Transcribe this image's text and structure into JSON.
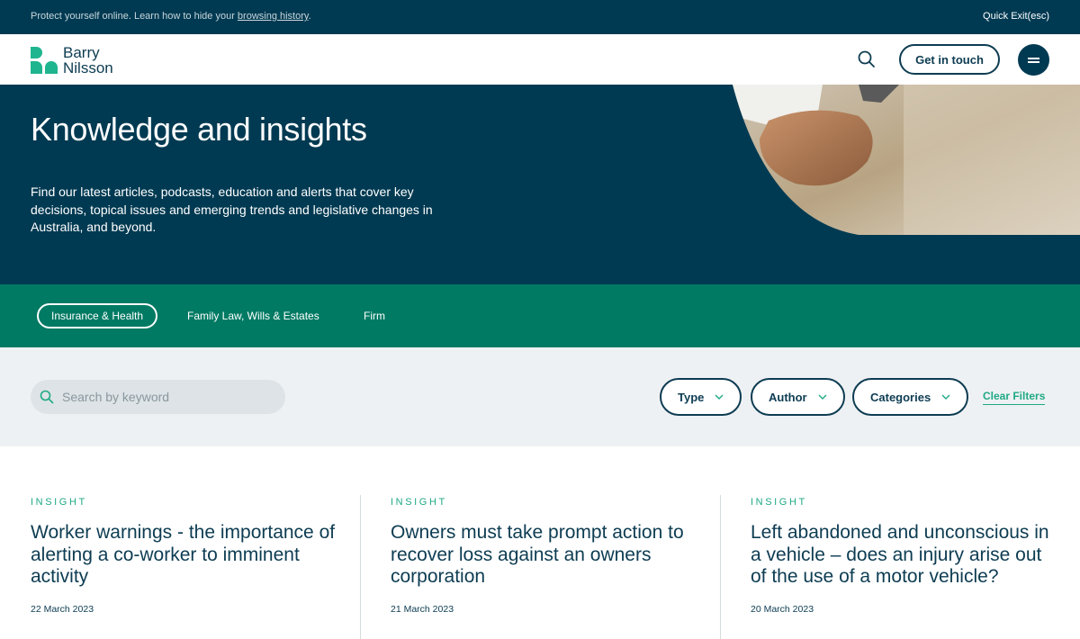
{
  "topbar": {
    "notice_text": "Protect yourself online. Learn how to hide your ",
    "notice_link": "browsing history",
    "notice_end": ".",
    "quick_exit": "Quick Exit(esc)"
  },
  "header": {
    "logo_line1": "Barry",
    "logo_line2": "Nilsson",
    "search_icon": "search-icon",
    "get_in_touch": "Get in touch",
    "menu_icon": "menu-icon"
  },
  "hero": {
    "title": "Knowledge and insights",
    "description": "Find our latest articles, podcasts, education and alerts that cover key decisions, topical issues and emerging trends and legislative changes in Australia, and beyond."
  },
  "tabs": [
    {
      "label": "Insurance & Health",
      "active": true
    },
    {
      "label": "Family Law, Wills & Estates",
      "active": false
    },
    {
      "label": "Firm",
      "active": false
    }
  ],
  "filters": {
    "search_placeholder": "Search by keyword",
    "type_label": "Type",
    "author_label": "Author",
    "categories_label": "Categories",
    "clear_label": "Clear Filters"
  },
  "cards": [
    {
      "kind": "INSIGHT",
      "title": "Worker warnings - the importance of alerting a co-worker to imminent activity",
      "date": "22 March 2023"
    },
    {
      "kind": "INSIGHT",
      "title": "Owners must take prompt action to recover loss against an owners corporation",
      "date": "21 March 2023"
    },
    {
      "kind": "INSIGHT",
      "title": "Left abandoned and unconscious in a vehicle – does an injury arise out of the use of a motor vehicle?",
      "date": "20 March 2023"
    }
  ],
  "colors": {
    "navy": "#003a52",
    "brand_green": "#1fb58f",
    "tab_green": "#007a63",
    "text": "#0d3c52"
  }
}
